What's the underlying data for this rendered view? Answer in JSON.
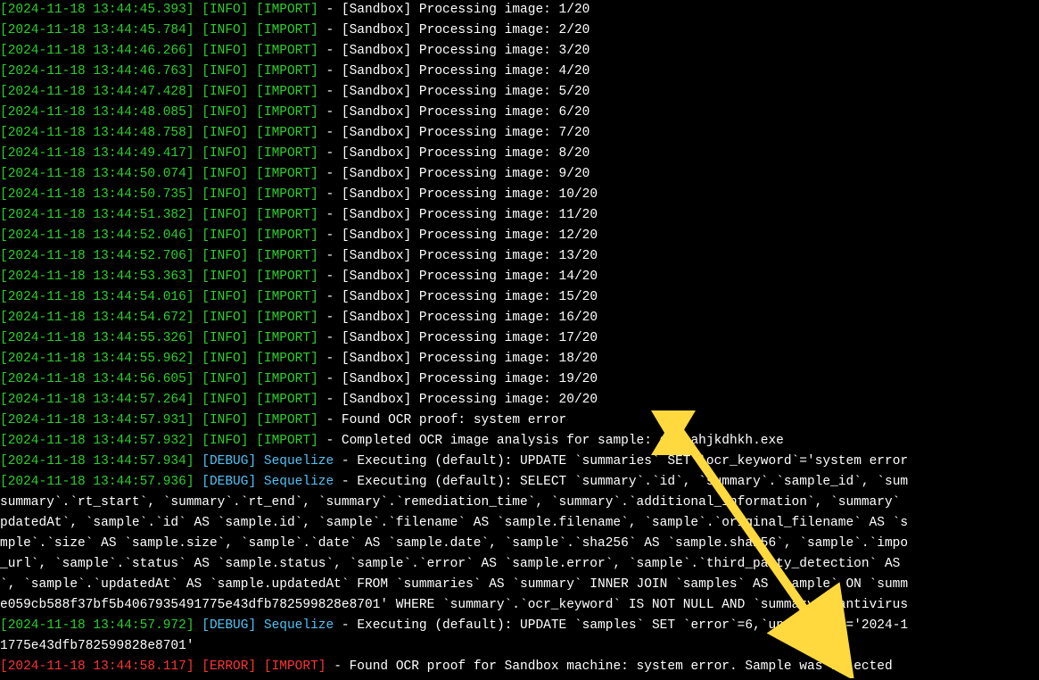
{
  "colors": {
    "green": "#2bd02b",
    "blue": "#4fc3f7",
    "red": "#ff3333",
    "white": "#ffffff",
    "arrow": "#ffd93d"
  },
  "lines": [
    {
      "ts": "[2024-11-18 13:44:45.393]",
      "level": "[INFO]",
      "tag": "[IMPORT]",
      "levelClass": "info",
      "tagClass": "import",
      "msg": "[Sandbox] Processing image: 1/20"
    },
    {
      "ts": "[2024-11-18 13:44:45.784]",
      "level": "[INFO]",
      "tag": "[IMPORT]",
      "levelClass": "info",
      "tagClass": "import",
      "msg": "[Sandbox] Processing image: 2/20"
    },
    {
      "ts": "[2024-11-18 13:44:46.266]",
      "level": "[INFO]",
      "tag": "[IMPORT]",
      "levelClass": "info",
      "tagClass": "import",
      "msg": "[Sandbox] Processing image: 3/20"
    },
    {
      "ts": "[2024-11-18 13:44:46.763]",
      "level": "[INFO]",
      "tag": "[IMPORT]",
      "levelClass": "info",
      "tagClass": "import",
      "msg": "[Sandbox] Processing image: 4/20"
    },
    {
      "ts": "[2024-11-18 13:44:47.428]",
      "level": "[INFO]",
      "tag": "[IMPORT]",
      "levelClass": "info",
      "tagClass": "import",
      "msg": "[Sandbox] Processing image: 5/20"
    },
    {
      "ts": "[2024-11-18 13:44:48.085]",
      "level": "[INFO]",
      "tag": "[IMPORT]",
      "levelClass": "info",
      "tagClass": "import",
      "msg": "[Sandbox] Processing image: 6/20"
    },
    {
      "ts": "[2024-11-18 13:44:48.758]",
      "level": "[INFO]",
      "tag": "[IMPORT]",
      "levelClass": "info",
      "tagClass": "import",
      "msg": "[Sandbox] Processing image: 7/20"
    },
    {
      "ts": "[2024-11-18 13:44:49.417]",
      "level": "[INFO]",
      "tag": "[IMPORT]",
      "levelClass": "info",
      "tagClass": "import",
      "msg": "[Sandbox] Processing image: 8/20"
    },
    {
      "ts": "[2024-11-18 13:44:50.074]",
      "level": "[INFO]",
      "tag": "[IMPORT]",
      "levelClass": "info",
      "tagClass": "import",
      "msg": "[Sandbox] Processing image: 9/20"
    },
    {
      "ts": "[2024-11-18 13:44:50.735]",
      "level": "[INFO]",
      "tag": "[IMPORT]",
      "levelClass": "info",
      "tagClass": "import",
      "msg": "[Sandbox] Processing image: 10/20"
    },
    {
      "ts": "[2024-11-18 13:44:51.382]",
      "level": "[INFO]",
      "tag": "[IMPORT]",
      "levelClass": "info",
      "tagClass": "import",
      "msg": "[Sandbox] Processing image: 11/20"
    },
    {
      "ts": "[2024-11-18 13:44:52.046]",
      "level": "[INFO]",
      "tag": "[IMPORT]",
      "levelClass": "info",
      "tagClass": "import",
      "msg": "[Sandbox] Processing image: 12/20"
    },
    {
      "ts": "[2024-11-18 13:44:52.706]",
      "level": "[INFO]",
      "tag": "[IMPORT]",
      "levelClass": "info",
      "tagClass": "import",
      "msg": "[Sandbox] Processing image: 13/20"
    },
    {
      "ts": "[2024-11-18 13:44:53.363]",
      "level": "[INFO]",
      "tag": "[IMPORT]",
      "levelClass": "info",
      "tagClass": "import",
      "msg": "[Sandbox] Processing image: 14/20"
    },
    {
      "ts": "[2024-11-18 13:44:54.016]",
      "level": "[INFO]",
      "tag": "[IMPORT]",
      "levelClass": "info",
      "tagClass": "import",
      "msg": "[Sandbox] Processing image: 15/20"
    },
    {
      "ts": "[2024-11-18 13:44:54.672]",
      "level": "[INFO]",
      "tag": "[IMPORT]",
      "levelClass": "info",
      "tagClass": "import",
      "msg": "[Sandbox] Processing image: 16/20"
    },
    {
      "ts": "[2024-11-18 13:44:55.326]",
      "level": "[INFO]",
      "tag": "[IMPORT]",
      "levelClass": "info",
      "tagClass": "import",
      "msg": "[Sandbox] Processing image: 17/20"
    },
    {
      "ts": "[2024-11-18 13:44:55.962]",
      "level": "[INFO]",
      "tag": "[IMPORT]",
      "levelClass": "info",
      "tagClass": "import",
      "msg": "[Sandbox] Processing image: 18/20"
    },
    {
      "ts": "[2024-11-18 13:44:56.605]",
      "level": "[INFO]",
      "tag": "[IMPORT]",
      "levelClass": "info",
      "tagClass": "import",
      "msg": "[Sandbox] Processing image: 19/20"
    },
    {
      "ts": "[2024-11-18 13:44:57.264]",
      "level": "[INFO]",
      "tag": "[IMPORT]",
      "levelClass": "info",
      "tagClass": "import",
      "msg": "[Sandbox] Processing image: 20/20"
    },
    {
      "ts": "[2024-11-18 13:44:57.931]",
      "level": "[INFO]",
      "tag": "[IMPORT]",
      "levelClass": "info",
      "tagClass": "import",
      "msg": "Found OCR proof: system error"
    },
    {
      "ts": "[2024-11-18 13:44:57.932]",
      "level": "[INFO]",
      "tag": "[IMPORT]",
      "levelClass": "info",
      "tagClass": "import",
      "msg": "Completed OCR image analysis for sample: djksahjkdhkh.exe"
    },
    {
      "ts": "[2024-11-18 13:44:57.934]",
      "level": "[DEBUG]",
      "tag": "Sequelize",
      "levelClass": "debug",
      "tagClass": "sequel",
      "msg": "Executing (default): UPDATE `summaries` SET `ocr_keyword`='system error"
    },
    {
      "ts": "[2024-11-18 13:44:57.936]",
      "level": "[DEBUG]",
      "tag": "Sequelize",
      "levelClass": "debug",
      "tagClass": "sequel",
      "msg": "Executing (default): SELECT `summary`.`id`, `summary`.`sample_id`, `sum"
    }
  ],
  "wrapped_white": "summary`.`rt_start`, `summary`.`rt_end`, `summary`.`remediation_time`, `summary`.`additional_information`, `summary`\npdatedAt`, `sample`.`id` AS `sample.id`, `sample`.`filename` AS `sample.filename`, `sample`.`original_filename` AS `s\nmple`.`size` AS `sample.size`, `sample`.`date` AS `sample.date`, `sample`.`sha256` AS `sample.sha256`, `sample`.`impo\n_url`, `sample`.`status` AS `sample.status`, `sample`.`error` AS `sample.error`, `sample`.`third_party_detection` AS \n`, `sample`.`updatedAt` AS `sample.updatedAt` FROM `summaries` AS `summary` INNER JOIN `samples` AS `sample` ON `summ\ne059cb588f37bf5b4067935491775e43dfb782599828e8701' WHERE `summary`.`ocr_keyword` IS NOT NULL AND `summary`.`antivirus",
  "line_after": {
    "ts": "[2024-11-18 13:44:57.972]",
    "level": "[DEBUG]",
    "tag": "Sequelize",
    "levelClass": "debug",
    "tagClass": "sequel",
    "msg": "Executing (default): UPDATE `samples` SET `error`=6,`updatedAt`='2024-1"
  },
  "wrapped_white_2": "1775e43dfb782599828e8701'",
  "final_line": {
    "ts": "[2024-11-18 13:44:58.117]",
    "level": "[ERROR]",
    "tag": "[IMPORT]",
    "levelClass": "error",
    "tagClass": "error",
    "tsClass": "error",
    "msg": "Found OCR proof for Sandbox machine: system error. Sample was rejected "
  }
}
